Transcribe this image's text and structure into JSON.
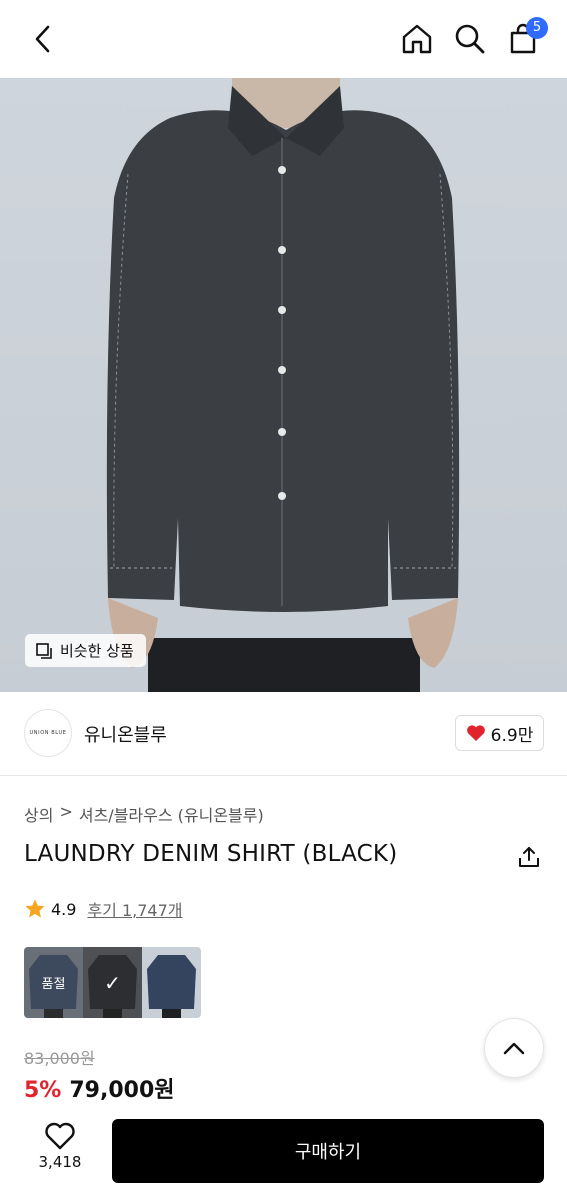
{
  "header": {
    "back_icon": "chevron-left-icon",
    "home_icon": "home-icon",
    "search_icon": "search-icon",
    "cart_icon": "shopping-bag-icon",
    "cart_count": "5",
    "badge_color": "#2f6bff"
  },
  "hero": {
    "similar_products_label": "비슷한 상품"
  },
  "brand": {
    "logo_text": "UNION BLUE",
    "name": "유니온블루",
    "likes": "6.9만",
    "heart_color": "#e0242e"
  },
  "breadcrumb": {
    "category": "상의",
    "separator": ">",
    "subcategory": "셔츠/블라우스 (유니온블루)"
  },
  "product": {
    "title": "LAUNDRY DENIM SHIRT (BLACK)",
    "rating": "4.9",
    "reviews": "후기 1,747개",
    "star_color": "#f5a623"
  },
  "swatches": [
    {
      "label": "품절",
      "state": "sold-out"
    },
    {
      "label": "✓",
      "state": "selected"
    },
    {
      "label": "",
      "state": "available"
    }
  ],
  "pricing": {
    "original_price": "83,000원",
    "discount": "5%",
    "sale_price": "79,000원",
    "discount_color": "#e0242e"
  },
  "bottom_bar": {
    "wish_count": "3,418",
    "buy_label": "구매하기"
  }
}
